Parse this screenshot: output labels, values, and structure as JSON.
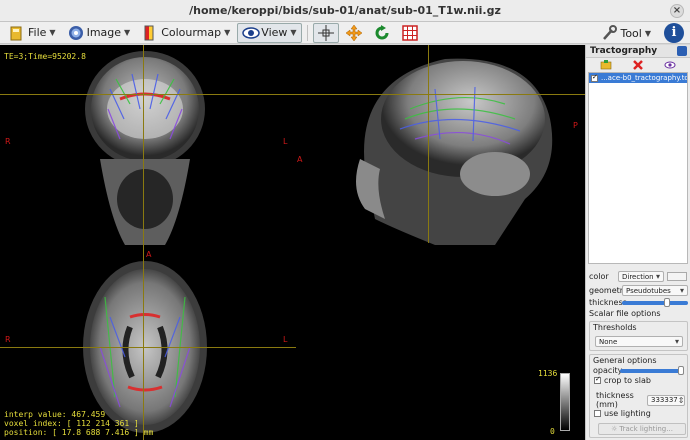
{
  "window": {
    "title": "/home/keroppi/bids/sub-01/anat/sub-01_T1w.nii.gz",
    "close_glyph": "×"
  },
  "toolbar": {
    "file_label": "File",
    "image_label": "Image",
    "colourmap_label": "Colourmap",
    "view_label": "View",
    "tool_label": "Tool",
    "info_glyph": "i"
  },
  "viewer": {
    "te_label": "TE=3;Time=95202.8",
    "interp_value": "interp value: 467.459",
    "voxel_index": "voxel index: [ 112 214 361 ]",
    "position": "position: [ 17.8 688 7.416 ] mm",
    "scale_max": "1136",
    "scale_min": "0",
    "orientation": {
      "coronal_left": "R",
      "coronal_right": "L",
      "sagittal_left": "A",
      "sagittal_right": "P",
      "axial_top": "A",
      "axial_left": "R",
      "axial_right": "L"
    }
  },
  "panel": {
    "title": "Tractography",
    "track_file": "...ace-b0_tractography.tck",
    "color_label": "color",
    "color_value": "Direction",
    "geometry_label": "geometry",
    "geometry_value": "Pseudotubes",
    "thickness_label": "thickness",
    "thickness_fraction": 0.68,
    "scalar_header": "Scalar file options",
    "thresholds_label": "Thresholds",
    "thresholds_value": "None",
    "general_header": "General options",
    "opacity_label": "opacity",
    "opacity_fraction": 0.98,
    "crop_label": "crop to slab",
    "crop_checked": true,
    "slab_thickness_label": "thickness (mm)",
    "slab_thickness_value": "333337",
    "lighting_label": "use lighting",
    "lighting_checked": false,
    "track_lighting_label": "Track lighting..."
  },
  "colors": {
    "hud_text": "#e7df3c",
    "orientation_text": "#d01818",
    "selection": "#3a7bd5"
  }
}
